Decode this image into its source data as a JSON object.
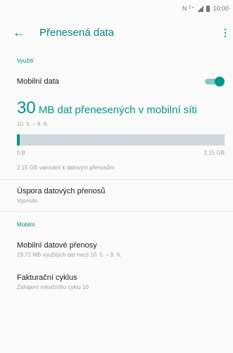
{
  "status_bar": {
    "indicators": "N ᵀ⁺",
    "time": "10:00"
  },
  "app_bar": {
    "title": "Přenesená data",
    "back_icon": "arrow-left",
    "more_icon": "more-vert"
  },
  "sections": {
    "usage": "Využití",
    "mobile": "Mobilní"
  },
  "mobile_data": {
    "label": "Mobilní data",
    "enabled": true
  },
  "usage": {
    "amount": "30",
    "unit_text": "MB dat přenesených v mobilní síti",
    "range": "10. 5. – 9. 6."
  },
  "usage_bar": {
    "min_label": "0 B",
    "max_label": "2,15 GB",
    "fill_fraction": 0.014
  },
  "warning_text": "2,15 GB varování k datovým přenosům",
  "data_saver": {
    "title": "Úspora datových přenosů",
    "status": "Vypnuto"
  },
  "mobile_transfers": {
    "title": "Mobilní datové přenosy",
    "subtitle": "29,72 MB využitých dat mezi 10. 5. – 9. 6."
  },
  "billing_cycle": {
    "title": "Fakturační cyklus",
    "subtitle": "Zahájení měsíčního cyklu 10"
  },
  "colors": {
    "accent": "#009688",
    "track": "#cfd8dc"
  }
}
